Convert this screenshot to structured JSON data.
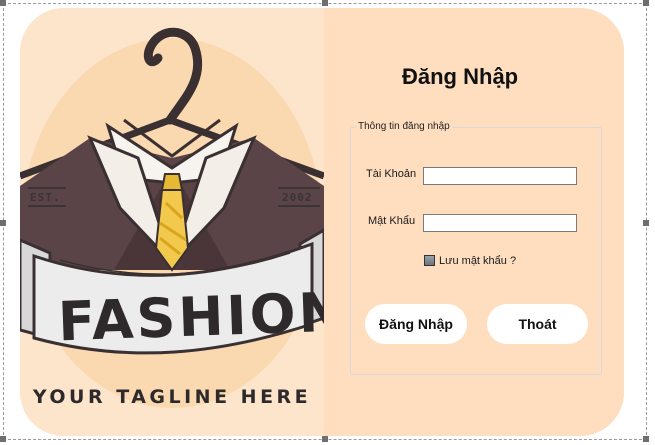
{
  "form": {
    "title": "Đăng Nhập",
    "groupbox_title": "Thông tin đăng nhập",
    "username": {
      "label": "Tài Khoản",
      "value": ""
    },
    "password": {
      "label": "Mật Khẩu",
      "value": ""
    },
    "remember": {
      "label": "Lưu mật khẩu ?",
      "checked": true
    },
    "login_button": "Đăng Nhập",
    "exit_button": "Thoát"
  },
  "logo": {
    "brand": "FASHION",
    "est": "EST.",
    "year": "2002",
    "tagline": "YOUR TAGLINE HERE"
  },
  "colors": {
    "left_panel": "#fde5cb",
    "right_panel": "#ffdec0",
    "jacket": "#5a4447",
    "tie": "#f2c94c",
    "ribbon": "#ececec"
  }
}
